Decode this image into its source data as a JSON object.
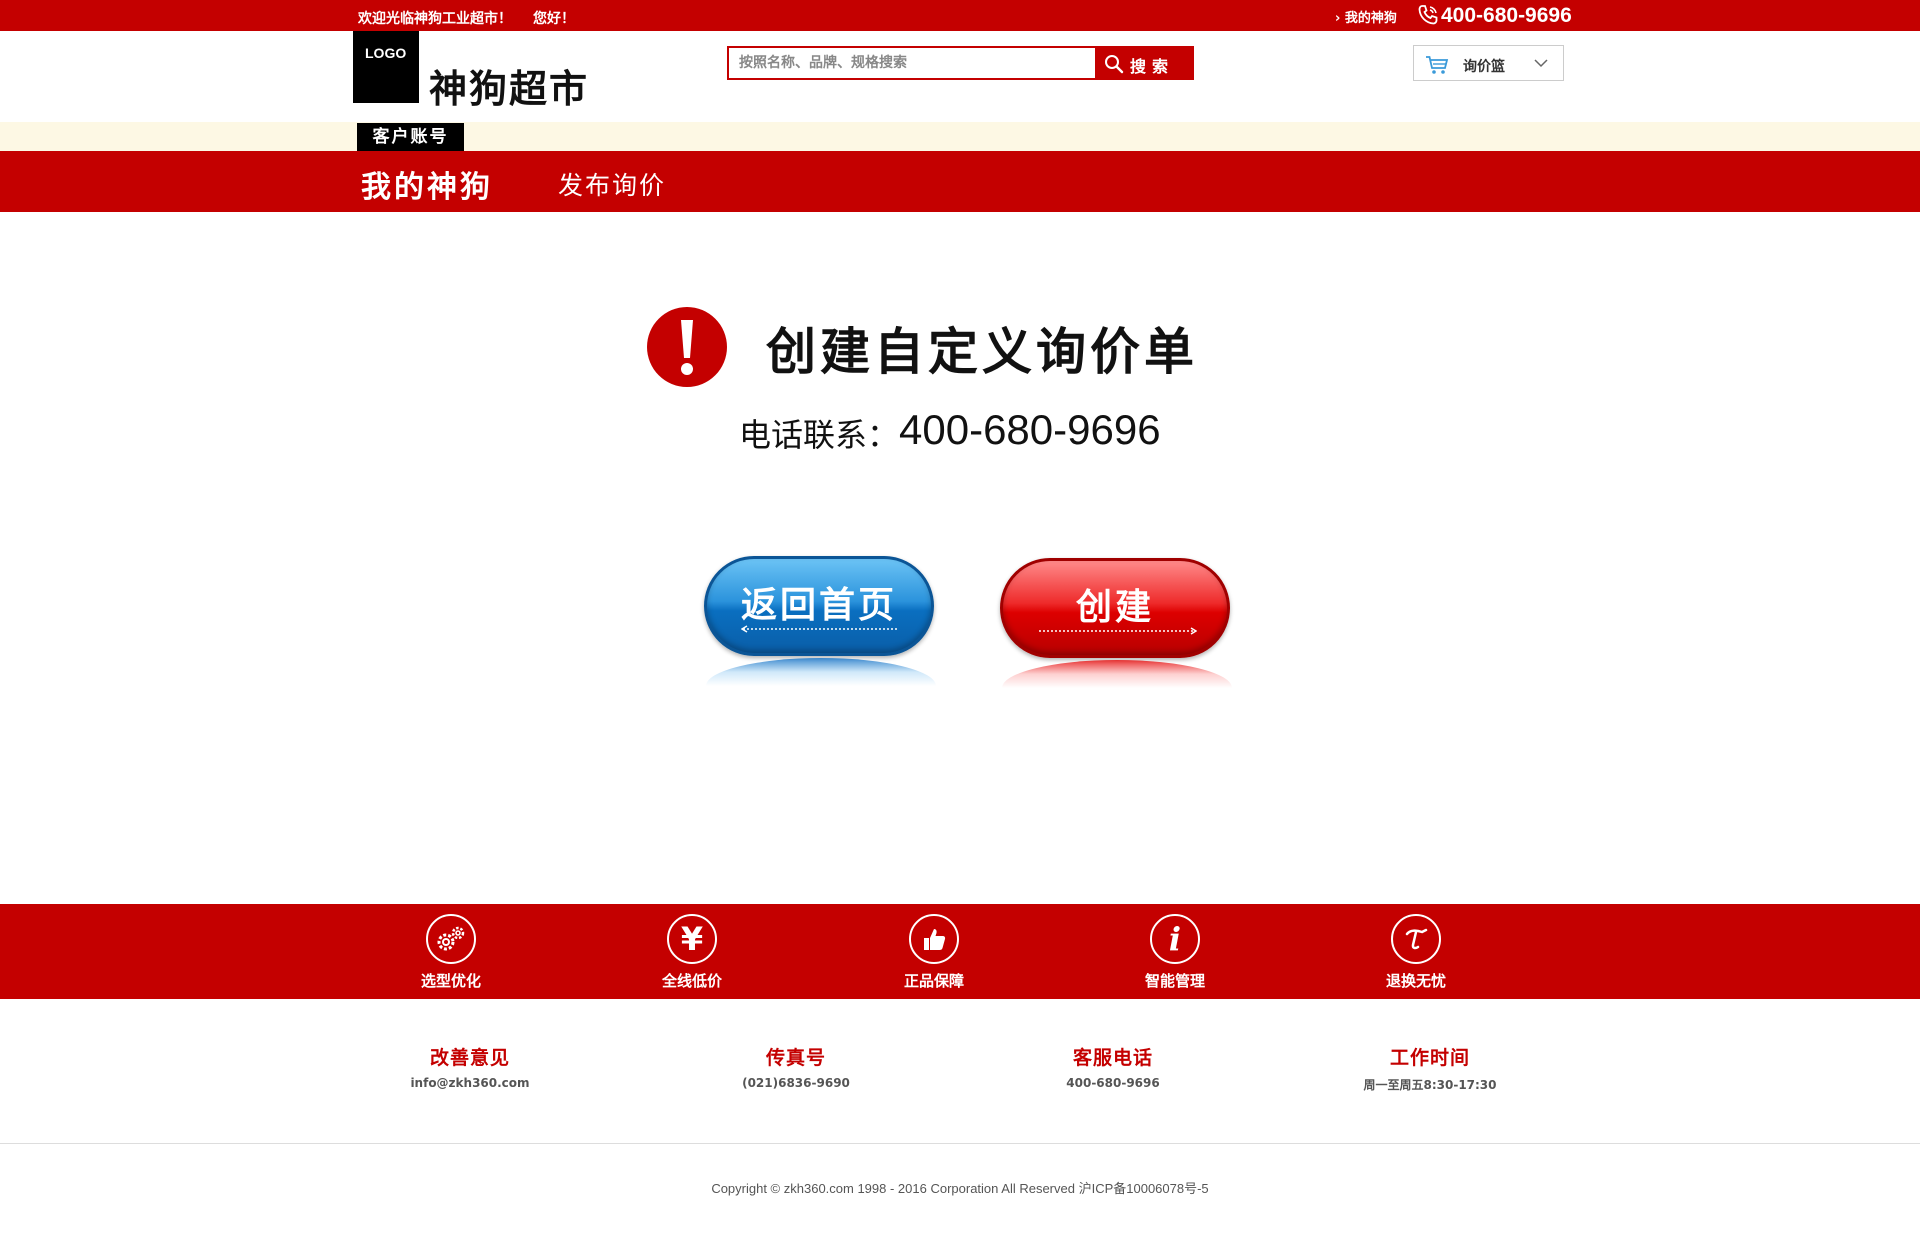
{
  "topbar": {
    "welcome": "欢迎光临神狗工业超市！",
    "hello": "您好！",
    "my_account_link": "› 我的神狗",
    "phone": "400-680-9696"
  },
  "header": {
    "logo_text": "LOGO",
    "site_name": "神狗超市",
    "search": {
      "placeholder": "按照名称、品牌、规格搜索",
      "button_label": "搜索"
    },
    "cart_label": "询价篮"
  },
  "account_tab": "客户账号",
  "nav": {
    "main_title": "我的神狗",
    "link": "发布询价"
  },
  "main": {
    "headline": "创建自定义询价单",
    "contact_label": "电话联系：",
    "contact_phone": "400-680-9696",
    "home_button": "返回首页",
    "create_button": "创建"
  },
  "features": [
    {
      "label": "选型优化",
      "icon": "gears-icon"
    },
    {
      "label": "全线低价",
      "icon": "yen-icon"
    },
    {
      "label": "正品保障",
      "icon": "thumbs-up-icon"
    },
    {
      "label": "智能管理",
      "icon": "info-icon"
    },
    {
      "label": "退换无忧",
      "icon": "return-icon"
    }
  ],
  "info": [
    {
      "title": "改善意见",
      "value": "info@zkh360.com"
    },
    {
      "title": "传真号",
      "value": "(021)6836-9690"
    },
    {
      "title": "客服电话",
      "value": "400-680-9696"
    },
    {
      "title": "工作时间",
      "value": "周一至周五8:30-17:30"
    }
  ],
  "footer": {
    "copyright": "Copyright © zkh360.com 1998 - 2016 Corporation All Reserved 沪ICP备10006078号-5"
  },
  "colors": {
    "brand_red": "#c40000",
    "cream": "#fdf8e4",
    "button_blue": "#1a7fd0"
  }
}
